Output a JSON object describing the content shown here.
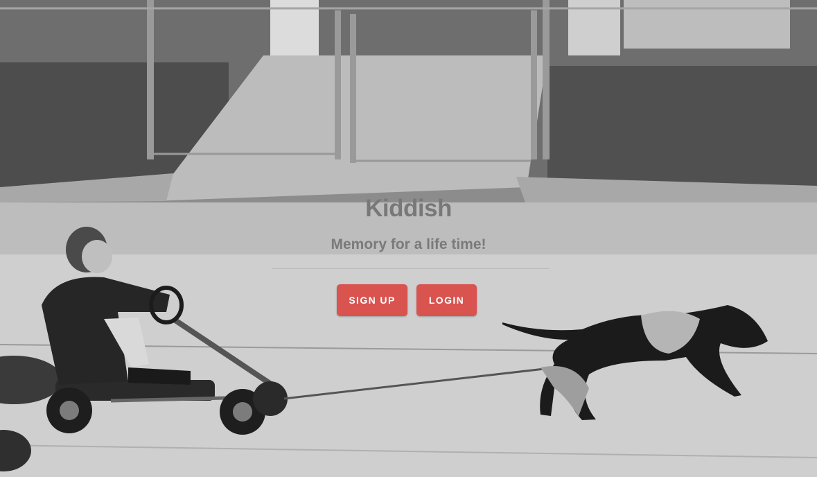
{
  "hero": {
    "image": "Black-and-white photo: boy in a pedal go-kart pulled on a rope by a running dog along a sidewalk, chain-link gate in background"
  },
  "brand": {
    "name": "Kiddish"
  },
  "tagline": {
    "text": "Memory for a life time!"
  },
  "actions": {
    "signup_label": "SIGN UP",
    "login_label": "LOGIN"
  },
  "colors": {
    "button_bg": "#d9534f",
    "button_text": "#ffffff",
    "heading_text": "#787878"
  }
}
